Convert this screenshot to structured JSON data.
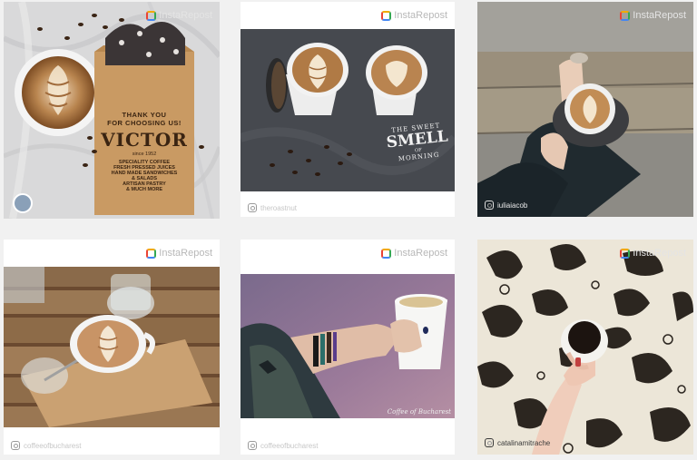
{
  "badge_label": "InstaRepost",
  "posts": [
    {
      "username": ""
    },
    {
      "username": "theroastnut"
    },
    {
      "username": "iuliaiacob"
    },
    {
      "username": "coffeeofbucharest"
    },
    {
      "username": "coffeeofbucharest"
    },
    {
      "username": "catalinamitrache"
    }
  ],
  "bag": {
    "line1": "THANK YOU",
    "line2": "FOR CHOOSING US!",
    "brand": "VICTOR",
    "since": "since 1952",
    "items": [
      "SPECIALITY COFFEE",
      "FRESH PRESSED JUICES",
      "HAND MADE SANDWICHES",
      "& SALADS",
      "ARTISAN PASTRY",
      "& MUCH MORE"
    ]
  },
  "smell": {
    "top": "THE SWEET",
    "mid": "SMELL",
    "of": "OF",
    "bottom": "MORNING"
  },
  "watermark": "Coffee of Bucharest"
}
